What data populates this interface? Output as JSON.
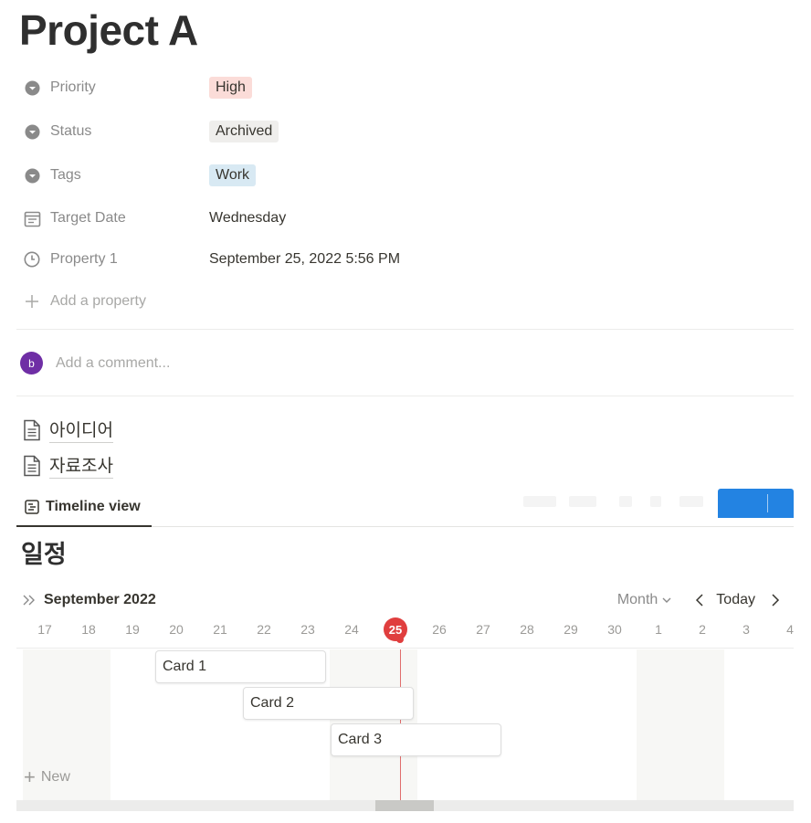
{
  "page": {
    "title": "Project A"
  },
  "properties": [
    {
      "label": "Priority",
      "icon": "select-icon",
      "type": "tag",
      "value": "High",
      "tag_bg": "#fbdcd8"
    },
    {
      "label": "Status",
      "icon": "select-icon",
      "type": "tag",
      "value": "Archived",
      "tag_bg": "#efeeec"
    },
    {
      "label": "Tags",
      "icon": "select-icon",
      "type": "tag",
      "value": "Work",
      "tag_bg": "#d8e9f3"
    },
    {
      "label": "Target Date",
      "icon": "calendar-icon",
      "type": "text",
      "value": "Wednesday"
    },
    {
      "label": "Property 1",
      "icon": "clock-icon",
      "type": "text",
      "value": "September 25, 2022 5:56 PM"
    }
  ],
  "add_property": {
    "label": "Add a property"
  },
  "comment": {
    "avatar_letter": "b",
    "placeholder": "Add a comment..."
  },
  "subpages": [
    {
      "label": "아이디어",
      "icon": "page-icon"
    },
    {
      "label": "자료조사",
      "icon": "page-icon"
    }
  ],
  "view_tab": {
    "label": "Timeline view",
    "icon": "timeline-view-icon"
  },
  "database": {
    "title": "일정"
  },
  "timeline": {
    "month_label": "September 2022",
    "mode": "Month",
    "today_label": "Today",
    "days": [
      "17",
      "18",
      "19",
      "20",
      "21",
      "22",
      "23",
      "24",
      "25",
      "26",
      "27",
      "28",
      "29",
      "30",
      "1",
      "2",
      "3",
      "4"
    ],
    "today": "25",
    "cards": [
      {
        "label": "Card 1",
        "start_day": "20",
        "end_day": "23"
      },
      {
        "label": "Card 2",
        "start_day": "22",
        "end_day": "25"
      },
      {
        "label": "Card 3",
        "start_day": "24",
        "end_day": "27"
      }
    ],
    "new_label": "New"
  },
  "colors": {
    "accent": "#2383e2",
    "today": "#e03e3e",
    "avatar": "#6f2ea5"
  }
}
